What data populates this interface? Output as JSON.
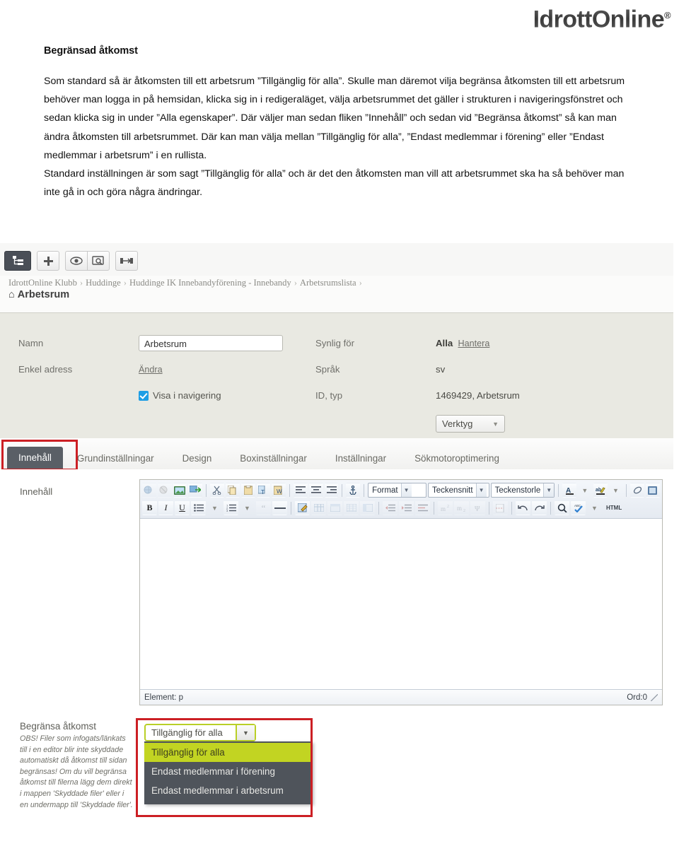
{
  "brand": {
    "name": "IdrottOnline",
    "reg": "®"
  },
  "document": {
    "heading": "Begränsad åtkomst",
    "body": "Som standard så är åtkomsten till ett arbetsrum ”Tillgänglig för alla”. Skulle man däremot vilja begränsa åtkomsten till ett arbetsrum behöver man logga in på hemsidan, klicka sig in i redigeraläget, välja arbetsrummet det gäller i strukturen i navigeringsfönstret och sedan klicka sig in under ”Alla egenskaper”. Där väljer man sedan fliken ”Innehåll” och sedan vid ”Begränsa åtkomst” så kan man ändra åtkomsten till arbetsrummet. Där kan man välja mellan ”Tillgänglig för alla”, ”Endast medlemmar i förening” eller ”Endast medlemmar i arbetsrum” i en rullista.",
    "body2": "Standard inställningen är som sagt ”Tillgänglig för alla” och är det den åtkomsten man vill att arbetsrummet ska ha så behöver man inte gå in och göra några ändringar."
  },
  "app_toolbar": {
    "buttons": [
      {
        "name": "structure-icon",
        "title": "Struktur",
        "active": true
      },
      {
        "name": "plus-icon",
        "title": "Lägg till"
      },
      {
        "name": "eye-icon",
        "title": "Förhandsgranska"
      },
      {
        "name": "preview-search-icon",
        "title": "Granska"
      },
      {
        "name": "resize-icon",
        "title": "Anpassa"
      }
    ]
  },
  "breadcrumb": {
    "items": [
      "IdrottOnline Klubb",
      "Huddinge",
      "Huddinge IK Innebandyförening - Innebandy",
      "Arbetsrumslista"
    ],
    "separator": "›",
    "page_title": "Arbetsrum"
  },
  "properties": {
    "left": {
      "namn_label": "Namn",
      "namn_value": "Arbetsrum",
      "enkel_adress_label": "Enkel adress",
      "enkel_adress_link": "Ändra",
      "visa_i_navigering_label": "Visa i navigering",
      "visa_i_navigering_checked": true
    },
    "right": {
      "synlig_label": "Synlig för",
      "synlig_value": "Alla",
      "synlig_link": "Hantera",
      "sprak_label": "Språk",
      "sprak_value": "sv",
      "idtyp_label": "ID, typ",
      "idtyp_value": "1469429, Arbetsrum",
      "verktyg_label": "Verktyg"
    }
  },
  "tabs": [
    {
      "label": "Innehåll",
      "active": true
    },
    {
      "label": "Grundinställningar",
      "active": false
    },
    {
      "label": "Design",
      "active": false
    },
    {
      "label": "Boxinställningar",
      "active": false
    },
    {
      "label": "Inställningar",
      "active": false
    },
    {
      "label": "Sökmotoroptimering",
      "active": false
    }
  ],
  "editor": {
    "section_label": "Innehåll",
    "format_label": "Format",
    "font_label": "Teckensnitt",
    "size_label": "Teckenstorle",
    "html_label": "HTML",
    "status_element": "Element: p",
    "status_words": "Ord:0"
  },
  "access": {
    "note_title": "Begränsa åtkomst",
    "note_text": "OBS! Filer som infogats/länkats till i en editor blir inte skyddade automatiskt då åtkomst till sidan begränsas! Om du vill begränsa åtkomst till filerna lägg dem direkt i mappen 'Skyddade filer' eller i en undermapp till 'Skyddade filer'.",
    "selected": "Tillgänglig för alla",
    "options": [
      "Tillgänglig för alla",
      "Endast medlemmar i förening",
      "Endast medlemmar i arbetsrum"
    ]
  },
  "colors": {
    "highlight_red": "#cc1f24",
    "option_green": "#c2d422",
    "panel_beige": "#e9e9e2",
    "tab_active": "#5a5f66",
    "checkbox_blue": "#1e9ee5"
  }
}
